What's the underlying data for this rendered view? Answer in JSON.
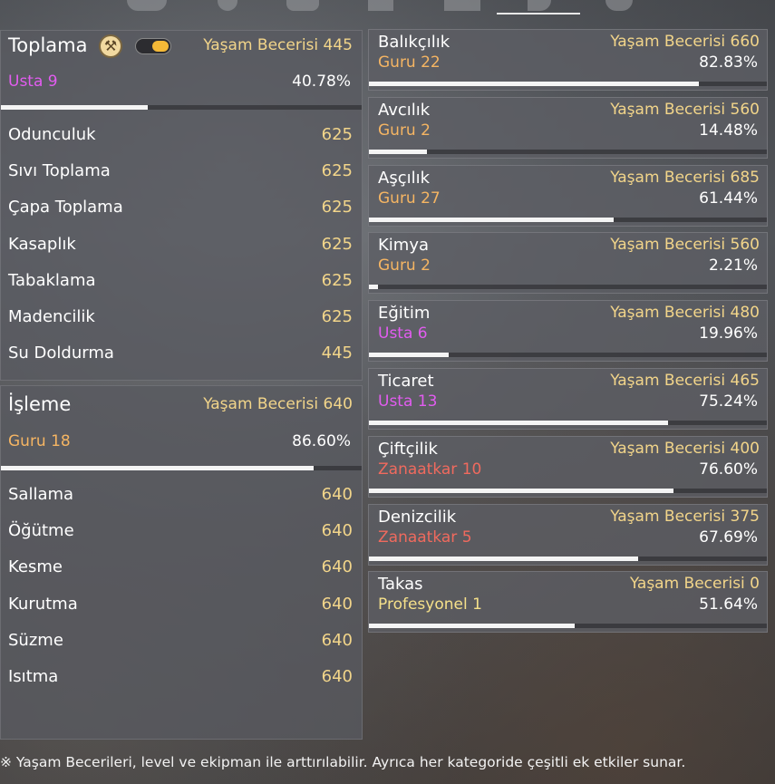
{
  "colors": {
    "rank_guru": "#f5b563",
    "rank_usta": "#e25cf0",
    "rank_zanaatkar": "#f06a5e",
    "rank_profesyonel": "#f5e08a",
    "skill_level": "#f2d58a"
  },
  "left_panels": [
    {
      "title": "Toplama",
      "skill_level": "Yaşam Becerisi 445",
      "rank": "Usta 9",
      "rank_color": "#e25cf0",
      "percent": "40.78%",
      "progress": 0.4078,
      "has_icon": true,
      "has_toggle": true,
      "sub_skills": [
        {
          "name": "Odunculuk",
          "value": "625"
        },
        {
          "name": "Sıvı Toplama",
          "value": "625"
        },
        {
          "name": "Çapa Toplama",
          "value": "625"
        },
        {
          "name": "Kasaplık",
          "value": "625"
        },
        {
          "name": "Tabaklama",
          "value": "625"
        },
        {
          "name": "Madencilik",
          "value": "625"
        },
        {
          "name": "Su Doldurma",
          "value": "445"
        }
      ]
    },
    {
      "title": "İşleme",
      "skill_level": "Yaşam Becerisi 640",
      "rank": "Guru 18",
      "rank_color": "#f5b563",
      "percent": "86.60%",
      "progress": 0.866,
      "has_icon": false,
      "has_toggle": false,
      "sub_skills": [
        {
          "name": "Sallama",
          "value": "640"
        },
        {
          "name": "Öğütme",
          "value": "640"
        },
        {
          "name": "Kesme",
          "value": "640"
        },
        {
          "name": "Kurutma",
          "value": "640"
        },
        {
          "name": "Süzme",
          "value": "640"
        },
        {
          "name": "Isıtma",
          "value": "640"
        }
      ]
    }
  ],
  "right_cards": [
    {
      "name": "Balıkçılık",
      "skill_level": "Yaşam Becerisi 660",
      "rank": "Guru 22",
      "rank_color": "#f5b563",
      "percent": "82.83%",
      "progress": 0.8283
    },
    {
      "name": "Avcılık",
      "skill_level": "Yaşam Becerisi 560",
      "rank": "Guru 2",
      "rank_color": "#f5b563",
      "percent": "14.48%",
      "progress": 0.1448
    },
    {
      "name": "Aşçılık",
      "skill_level": "Yaşam Becerisi 685",
      "rank": "Guru 27",
      "rank_color": "#f5b563",
      "percent": "61.44%",
      "progress": 0.6144
    },
    {
      "name": "Kimya",
      "skill_level": "Yaşam Becerisi 560",
      "rank": "Guru 2",
      "rank_color": "#f5b563",
      "percent": "2.21%",
      "progress": 0.0221
    },
    {
      "name": "Eğitim",
      "skill_level": "Yaşam Becerisi 480",
      "rank": "Usta 6",
      "rank_color": "#e25cf0",
      "percent": "19.96%",
      "progress": 0.1996
    },
    {
      "name": "Ticaret",
      "skill_level": "Yaşam Becerisi 465",
      "rank": "Usta 13",
      "rank_color": "#e25cf0",
      "percent": "75.24%",
      "progress": 0.7524
    },
    {
      "name": "Çiftçilik",
      "skill_level": "Yaşam Becerisi 400",
      "rank": "Zanaatkar 10",
      "rank_color": "#f06a5e",
      "percent": "76.60%",
      "progress": 0.766
    },
    {
      "name": "Denizcilik",
      "skill_level": "Yaşam Becerisi 375",
      "rank": "Zanaatkar 5",
      "rank_color": "#f06a5e",
      "percent": "67.69%",
      "progress": 0.6769
    },
    {
      "name": "Takas",
      "skill_level": "Yaşam Becerisi 0",
      "rank": "Profesyonel 1",
      "rank_color": "#f5e08a",
      "percent": "51.64%",
      "progress": 0.5164
    }
  ],
  "footnote": "※ Yaşam Becerileri, level ve ekipman ile arttırılabilir. Ayrıca her kategoride çeşitli ek etkiler sunar.",
  "icons": {
    "category_badge": "crossed-tools-icon",
    "toggle": "toggle-switch"
  }
}
